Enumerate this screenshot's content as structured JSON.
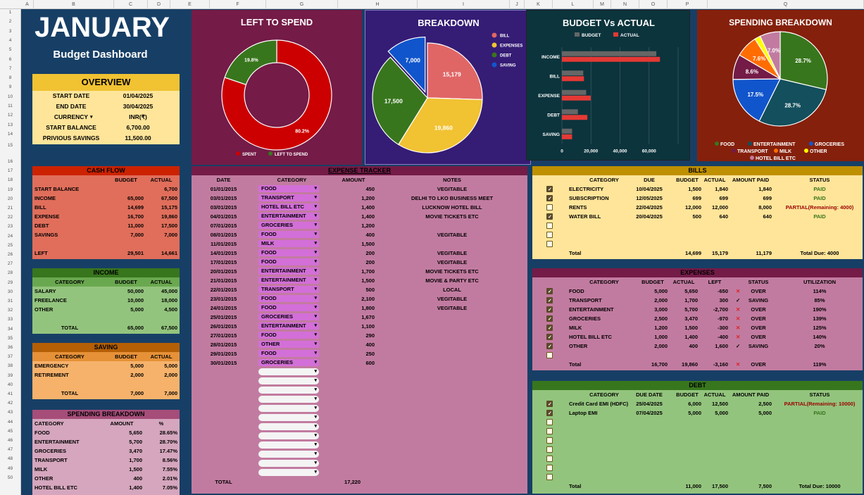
{
  "col_headers": [
    "A",
    "B",
    "C",
    "D",
    "E",
    "F",
    "G",
    "H",
    "I",
    "J",
    "K",
    "L",
    "M",
    "N",
    "O",
    "P",
    "Q"
  ],
  "row_headers": [
    "1",
    "2",
    "3",
    "4",
    "5",
    "6",
    "7",
    "8",
    "9",
    "10",
    "11",
    "12",
    "13",
    "14",
    "15",
    "16",
    "17",
    "18",
    "19",
    "20",
    "21",
    "22",
    "23",
    "24",
    "25",
    "26",
    "27",
    "28",
    "29",
    "30",
    "31",
    "32",
    "33",
    "34",
    "35",
    "36",
    "37",
    "38",
    "39",
    "40",
    "41",
    "42",
    "43",
    "44",
    "45",
    "46",
    "47",
    "48",
    "49",
    "50"
  ],
  "title": {
    "month": "JANUARY",
    "subtitle": "Budget Dashboard"
  },
  "overview": {
    "title": "OVERVIEW",
    "rows": [
      {
        "label": "START DATE",
        "value": "01/04/2025"
      },
      {
        "label": "END DATE",
        "value": "30/04/2025"
      },
      {
        "label": "CURRENCY",
        "value": "INR(₹)"
      },
      {
        "label": "START BALANCE",
        "value": "6,700.00"
      },
      {
        "label": "PRIVIOUS SAVINGS",
        "value": "11,500.00"
      }
    ]
  },
  "cash_flow": {
    "title": "CASH FLOW",
    "headers": [
      "",
      "BUDGET",
      "ACTUAL"
    ],
    "rows": [
      [
        "START BALANCE",
        "",
        "6,700"
      ],
      [
        "INCOME",
        "65,000",
        "67,500"
      ],
      [
        "BILL",
        "14,699",
        "15,175"
      ],
      [
        "EXPENSE",
        "16,700",
        "19,860"
      ],
      [
        "DEBT",
        "11,000",
        "17,500"
      ],
      [
        "SAVINGS",
        "7,000",
        "7,000"
      ],
      [
        "",
        "",
        ""
      ],
      [
        "LEFT",
        "29,501",
        "14,661"
      ]
    ]
  },
  "income": {
    "title": "INCOME",
    "headers": [
      "CATEGORY",
      "BUDGET",
      "ACTUAL"
    ],
    "rows": [
      [
        "SALARY",
        "50,000",
        "45,000"
      ],
      [
        "FREELANCE",
        "10,000",
        "18,000"
      ],
      [
        "OTHER",
        "5,000",
        "4,500"
      ],
      [
        "",
        "",
        ""
      ]
    ],
    "total": [
      "TOTAL",
      "65,000",
      "67,500"
    ]
  },
  "saving": {
    "title": "SAVING",
    "headers": [
      "CATEGORY",
      "BUDGET",
      "ACTUAL"
    ],
    "rows": [
      [
        "EMERGENCY",
        "5,000",
        "5,000"
      ],
      [
        "RETIREMENT",
        "2,000",
        "2,000"
      ],
      [
        "",
        "",
        ""
      ]
    ],
    "total": [
      "TOTAL",
      "7,000",
      "7,000"
    ]
  },
  "spending_table": {
    "title": "SPENDING BREAKDOWN",
    "headers": [
      "CATEGORY",
      "AMOUNT",
      "%"
    ],
    "rows": [
      [
        "FOOD",
        "5,650",
        "28.65%"
      ],
      [
        "ENTERTAINMENT",
        "5,700",
        "28.70%"
      ],
      [
        "GROCERIES",
        "3,470",
        "17.47%"
      ],
      [
        "TRANSPORT",
        "1,700",
        "8.56%"
      ],
      [
        "MILK",
        "1,500",
        "7.55%"
      ],
      [
        "OTHER",
        "400",
        "2.01%"
      ],
      [
        "HOTEL BILL ETC",
        "1,400",
        "7.05%"
      ]
    ]
  },
  "expense_tracker": {
    "title": "EXPENSE TRACKER",
    "headers": [
      "DATE",
      "CATEGORY",
      "AMOUNT",
      "NOTES"
    ],
    "rows": [
      [
        "01/01/2015",
        "FOOD",
        "450",
        "VEGITABLE"
      ],
      [
        "03/01/2015",
        "TRANSPORT",
        "1,200",
        "DELHI TO LKO BUSINESS MEET"
      ],
      [
        "03/01/2015",
        "HOTEL BILL ETC",
        "1,400",
        "LUCKNOW HOTEL BILL"
      ],
      [
        "04/01/2015",
        "ENTERTAINMENT",
        "1,400",
        "MOVIE TICKETS ETC"
      ],
      [
        "07/01/2015",
        "GROCERIES",
        "1,200",
        ""
      ],
      [
        "08/01/2015",
        "FOOD",
        "400",
        "VEGITABLE"
      ],
      [
        "11/01/2015",
        "MILK",
        "1,500",
        ""
      ],
      [
        "14/01/2015",
        "FOOD",
        "200",
        "VEGITABLE"
      ],
      [
        "17/01/2015",
        "FOOD",
        "200",
        "VEGITABLE"
      ],
      [
        "20/01/2015",
        "ENTERTAINMENT",
        "1,700",
        "MOVIE TICKETS ETC"
      ],
      [
        "21/01/2015",
        "ENTERTAINMENT",
        "1,500",
        "MOVIE & PARTY ETC"
      ],
      [
        "22/01/2015",
        "TRANSPORT",
        "500",
        "LOCAL"
      ],
      [
        "23/01/2015",
        "FOOD",
        "2,100",
        "VEGITABLE"
      ],
      [
        "24/01/2015",
        "FOOD",
        "1,800",
        "VEGITABLE"
      ],
      [
        "25/01/2015",
        "GROCERIES",
        "1,670",
        ""
      ],
      [
        "26/01/2015",
        "ENTERTAINMENT",
        "1,100",
        ""
      ],
      [
        "27/01/2015",
        "FOOD",
        "290",
        ""
      ],
      [
        "28/01/2015",
        "OTHER",
        "400",
        ""
      ],
      [
        "29/01/2015",
        "FOOD",
        "250",
        ""
      ],
      [
        "30/01/2015",
        "GROCERIES",
        "600",
        ""
      ]
    ],
    "empty_rows": 12,
    "total_label": "TOTAL",
    "total": "17,220"
  },
  "bills": {
    "title": "BILLS",
    "headers": [
      "CATEGORY",
      "DUE",
      "BUDGET",
      "ACTUAL",
      "AMOUNT PAID",
      "STATUS"
    ],
    "rows": [
      {
        "checked": true,
        "cells": [
          "ELECTRICITY",
          "10/04/2025",
          "1,500",
          "1,840",
          "1,840",
          "PAID"
        ]
      },
      {
        "checked": true,
        "cells": [
          "SUBSCRIPTION",
          "12/05/2025",
          "699",
          "699",
          "699",
          "PAID"
        ]
      },
      {
        "checked": false,
        "cells": [
          "RENTS",
          "22/04/2025",
          "12,000",
          "12,000",
          "8,000",
          "PARTIAL(Remaining: 4000)"
        ]
      },
      {
        "checked": true,
        "cells": [
          "WATER BILL",
          "20/04/2025",
          "500",
          "640",
          "640",
          "PAID"
        ]
      },
      {
        "checked": false,
        "cells": [
          "",
          "",
          "",
          "",
          "",
          ""
        ]
      },
      {
        "checked": false,
        "cells": [
          "",
          "",
          "",
          "",
          "",
          ""
        ]
      },
      {
        "checked": false,
        "cells": [
          "",
          "",
          "",
          "",
          "",
          ""
        ]
      }
    ],
    "total": [
      "Total",
      "",
      "14,699",
      "15,179",
      "11,179",
      "Total Due: 4000"
    ]
  },
  "expenses": {
    "title": "EXPENSES",
    "headers": [
      "CATEGORY",
      "BUDGET",
      "ACTUAL",
      "LEFT",
      "STATUS",
      "UTILIZATION"
    ],
    "rows": [
      {
        "checked": true,
        "cells": [
          "FOOD",
          "5,000",
          "5,650",
          "-650",
          "OVER",
          "114%"
        ]
      },
      {
        "checked": true,
        "cells": [
          "TRANSPORT",
          "2,000",
          "1,700",
          "300",
          "SAVING",
          "85%"
        ]
      },
      {
        "checked": true,
        "cells": [
          "ENTERTAINMENT",
          "3,000",
          "5,700",
          "-2,700",
          "OVER",
          "190%"
        ]
      },
      {
        "checked": true,
        "cells": [
          "GROCERIES",
          "2,500",
          "3,470",
          "-970",
          "OVER",
          "139%"
        ]
      },
      {
        "checked": true,
        "cells": [
          "MILK",
          "1,200",
          "1,500",
          "-300",
          "OVER",
          "125%"
        ]
      },
      {
        "checked": true,
        "cells": [
          "HOTEL BILL ETC",
          "1,000",
          "1,400",
          "-400",
          "OVER",
          "140%"
        ]
      },
      {
        "checked": true,
        "cells": [
          "OTHER",
          "2,000",
          "400",
          "1,600",
          "SAVING",
          "20%"
        ]
      },
      {
        "checked": false,
        "cells": [
          "",
          "",
          "",
          "",
          "",
          ""
        ]
      }
    ],
    "total": [
      "Total",
      "16,700",
      "19,860",
      "-3,160",
      "OVER",
      "119%"
    ],
    "status_icons": {
      "OVER": "✕",
      "SAVING": "✓"
    }
  },
  "debt": {
    "title": "DEBT",
    "headers": [
      "CATEGORY",
      "DUE DATE",
      "BUDGET",
      "ACTUAL",
      "AMOUNT PAID",
      "STATUS"
    ],
    "rows": [
      {
        "checked": true,
        "cells": [
          "Credit Card EMI (HDFC)",
          "25/04/2025",
          "6,000",
          "12,500",
          "2,500",
          "PARTIAL(Remaining: 10000)"
        ]
      },
      {
        "checked": true,
        "cells": [
          "Laptop EMI",
          "07/04/2025",
          "5,000",
          "5,000",
          "5,000",
          "PAID"
        ]
      },
      {
        "checked": false,
        "cells": [
          "",
          "",
          "",
          "",
          "",
          ""
        ]
      },
      {
        "checked": false,
        "cells": [
          "",
          "",
          "",
          "",
          "",
          ""
        ]
      },
      {
        "checked": false,
        "cells": [
          "",
          "",
          "",
          "",
          "",
          ""
        ]
      },
      {
        "checked": false,
        "cells": [
          "",
          "",
          "",
          "",
          "",
          ""
        ]
      },
      {
        "checked": false,
        "cells": [
          "",
          "",
          "",
          "",
          "",
          ""
        ]
      },
      {
        "checked": false,
        "cells": [
          "",
          "",
          "",
          "",
          "",
          ""
        ]
      },
      {
        "checked": false,
        "cells": [
          "",
          "",
          "",
          "",
          "",
          ""
        ]
      }
    ],
    "total": [
      "Total",
      "",
      "11,000",
      "17,500",
      "7,500",
      "Total Due: 10000"
    ]
  },
  "chart_data": [
    {
      "type": "pie",
      "title": "LEFT TO SPEND",
      "donut": true,
      "slices": [
        {
          "label": "SPENT",
          "value": 80.2,
          "display": "80.2%",
          "color": "#cc0000"
        },
        {
          "label": "LEFT TO SPEND",
          "value": 19.8,
          "display": "19.8%",
          "color": "#38761d"
        }
      ],
      "legend": "bottom"
    },
    {
      "type": "pie",
      "title": "BREAKDOWN",
      "slices": [
        {
          "label": "BILL",
          "value": 15179,
          "display": "15,179",
          "color": "#e06666"
        },
        {
          "label": "EXPENSES",
          "value": 19860,
          "display": "19,860",
          "color": "#f1c232"
        },
        {
          "label": "DEBT",
          "value": 17500,
          "display": "17,500",
          "color": "#38761d"
        },
        {
          "label": "SAVING",
          "value": 7000,
          "display": "7,000",
          "color": "#1155cc"
        }
      ],
      "legend": "right"
    },
    {
      "type": "bar",
      "orientation": "horizontal",
      "title": "BUDGET Vs ACTUAL",
      "categories": [
        "INCOME",
        "BILL",
        "EXPENSE",
        "DEBT",
        "SAVING"
      ],
      "series": [
        {
          "name": "BUDGET",
          "values": [
            65000,
            14699,
            16700,
            11000,
            7000
          ],
          "color": "#666666"
        },
        {
          "name": "ACTUAL",
          "values": [
            67500,
            15179,
            19860,
            17500,
            7000
          ],
          "color": "#e53935"
        }
      ],
      "xlim": [
        0,
        80000
      ],
      "xticks": [
        "0",
        "20,000",
        "40,000",
        "60,000"
      ],
      "legend": "top"
    },
    {
      "type": "pie",
      "title": "SPENDING BREAKDOWN",
      "slices": [
        {
          "label": "FOOD",
          "value": 28.7,
          "display": "28.7%",
          "color": "#38761d"
        },
        {
          "label": "ENTERTAINMENT",
          "value": 28.7,
          "display": "28.7%",
          "color": "#134f5c"
        },
        {
          "label": "GROCERIES",
          "value": 17.5,
          "display": "17.5%",
          "color": "#1155cc"
        },
        {
          "label": "TRANSPORT",
          "value": 8.6,
          "display": "8.6%",
          "color": "#741b47"
        },
        {
          "label": "MILK",
          "value": 7.6,
          "display": "7.6%",
          "color": "#ff6d01"
        },
        {
          "label": "OTHER",
          "value": 2.0,
          "display": "",
          "color": "#ffff00"
        },
        {
          "label": "HOTEL BILL ETC",
          "value": 7.0,
          "display": "7.0%",
          "color": "#c27ba0"
        }
      ],
      "legend": "bottom"
    }
  ]
}
